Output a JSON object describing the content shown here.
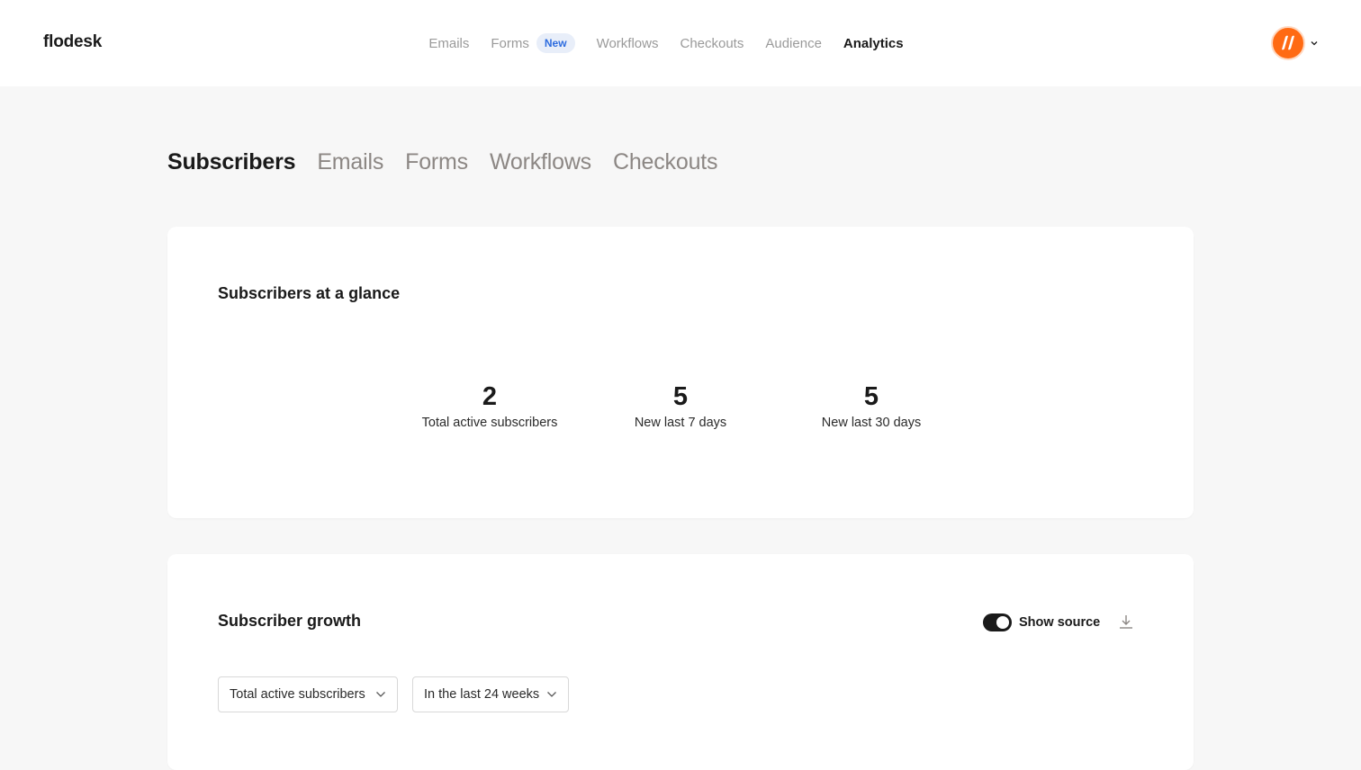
{
  "app": {
    "logo": "flodesk"
  },
  "main_nav": {
    "items": [
      {
        "label": "Emails"
      },
      {
        "label": "Forms",
        "badge": "New"
      },
      {
        "label": "Workflows"
      },
      {
        "label": "Checkouts"
      },
      {
        "label": "Audience"
      },
      {
        "label": "Analytics",
        "active": true
      }
    ]
  },
  "account": {
    "avatar_icon": "brand-avatar-icon",
    "avatar_color": "#ff6a13"
  },
  "sub_tabs": {
    "items": [
      {
        "label": "Subscribers",
        "active": true
      },
      {
        "label": "Emails"
      },
      {
        "label": "Forms"
      },
      {
        "label": "Workflows"
      },
      {
        "label": "Checkouts"
      }
    ]
  },
  "glance": {
    "title": "Subscribers at a glance",
    "stats": [
      {
        "value": "2",
        "label": "Total active subscribers"
      },
      {
        "value": "5",
        "label": "New last 7 days"
      },
      {
        "value": "5",
        "label": "New last 30 days"
      }
    ]
  },
  "growth": {
    "title": "Subscriber growth",
    "show_source_label": "Show source",
    "show_source_on": true,
    "metric_select": "Total active subscribers",
    "range_select": "In the last 24 weeks"
  },
  "colors": {
    "accent": "#2d6cdf",
    "brand": "#ff6a13",
    "text": "#1a1a1a",
    "muted": "#9a9a9a"
  }
}
